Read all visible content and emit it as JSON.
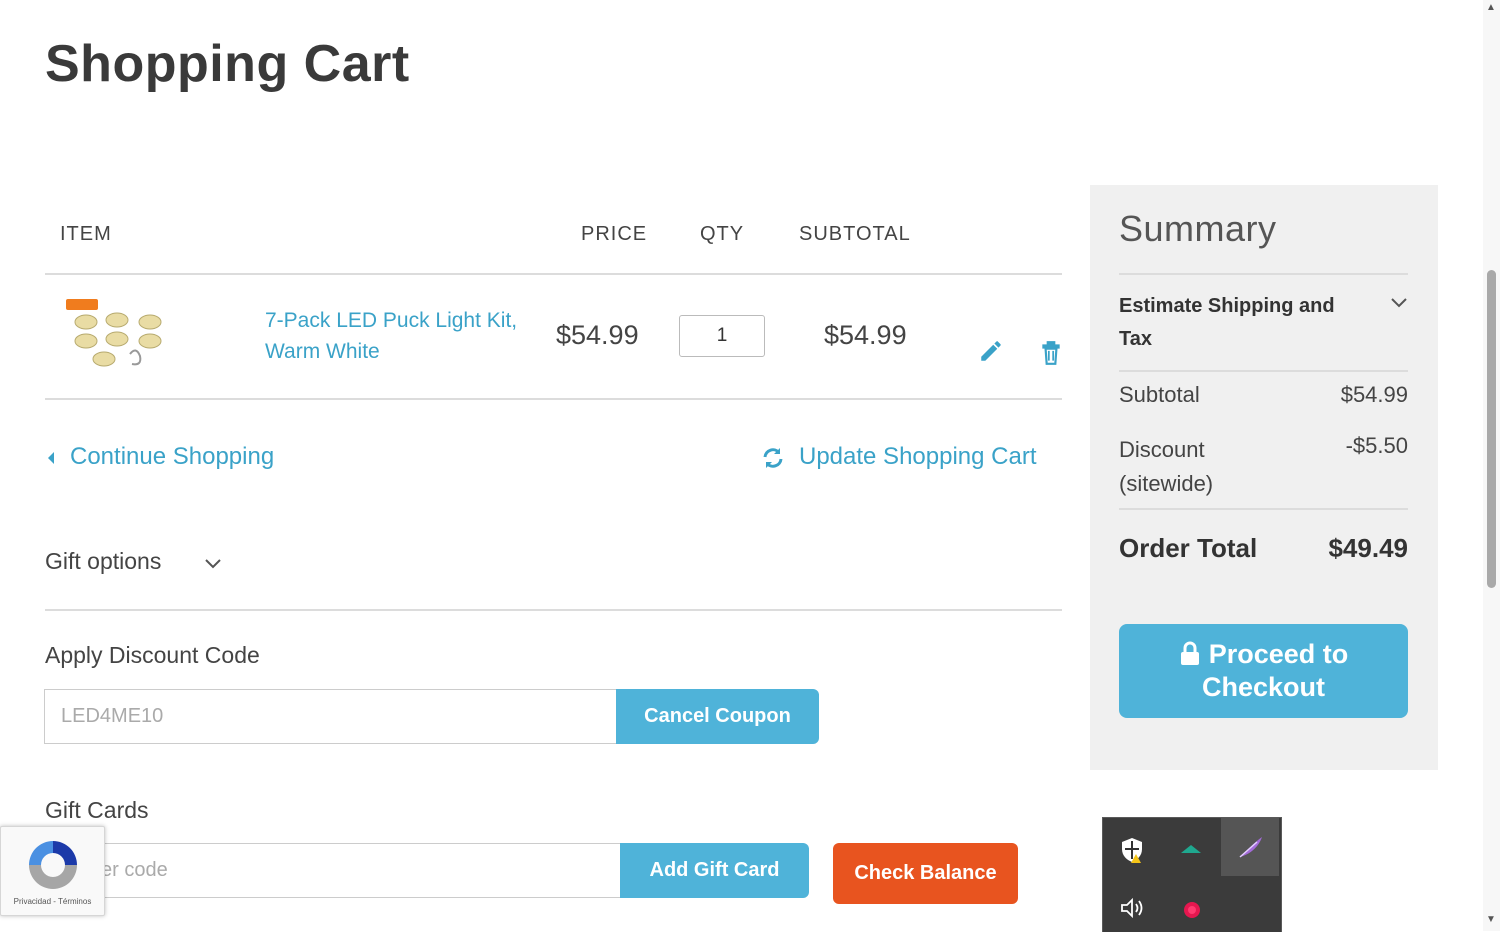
{
  "page": {
    "title": "Shopping Cart"
  },
  "table": {
    "headers": {
      "item": "ITEM",
      "price": "PRICE",
      "qty": "QTY",
      "subtotal": "SUBTOTAL"
    },
    "rows": [
      {
        "name": "7-Pack LED Puck Light Kit, Warm White",
        "price": "$54.99",
        "qty": "1",
        "subtotal": "$54.99"
      }
    ]
  },
  "actions": {
    "continue": "Continue Shopping",
    "update": "Update Shopping Cart"
  },
  "gift_options": {
    "label": "Gift options"
  },
  "discount": {
    "heading": "Apply Discount Code",
    "value": "LED4ME10",
    "button": "Cancel Coupon"
  },
  "gift_cards": {
    "heading": "Gift Cards",
    "placeholder": "er code",
    "add_button": "Add Gift Card",
    "check_button": "Check Balance"
  },
  "summary": {
    "title": "Summary",
    "shipping_toggle": "Estimate Shipping and Tax",
    "subtotal_label": "Subtotal",
    "subtotal_value": "$54.99",
    "discount_label": "Discount (sitewide)",
    "discount_value": "-$5.50",
    "total_label": "Order Total",
    "total_value": "$49.49",
    "checkout_button": "Proceed to Checkout"
  },
  "recaptcha": {
    "footer": "Privacidad - Términos"
  },
  "colors": {
    "accent": "#4fb3d9",
    "link": "#3aa2c8",
    "orange": "#e8541f",
    "summary_bg": "#f0f0f0"
  },
  "icons": [
    "pencil-icon",
    "trash-icon",
    "chevron-left-icon",
    "refresh-icon",
    "chevron-down-icon",
    "lock-icon",
    "shield-icon",
    "volume-icon"
  ]
}
